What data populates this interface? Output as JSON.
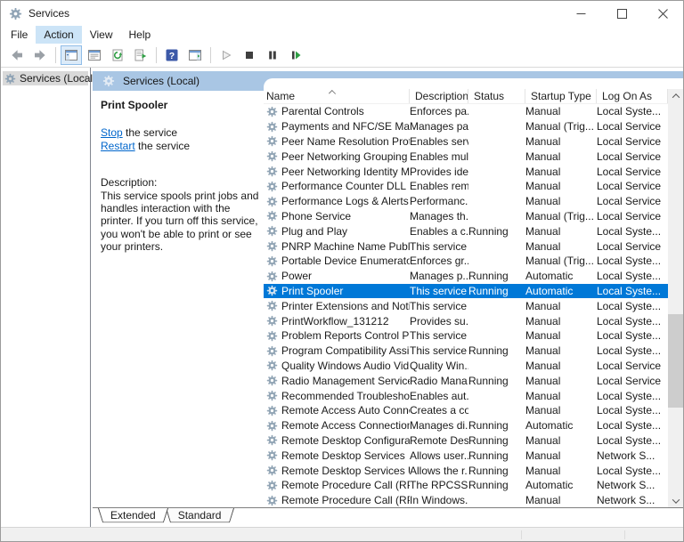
{
  "window": {
    "title": "Services"
  },
  "window_controls": [
    "minimize",
    "maximize",
    "close"
  ],
  "menu": {
    "items": [
      "File",
      "Action",
      "View",
      "Help"
    ],
    "active": "Action"
  },
  "toolbar": {
    "buttons": [
      "back",
      "forward",
      "show-console-tree",
      "properties",
      "refresh",
      "export-list",
      "help",
      "show-action-pane",
      "start-service",
      "stop-service",
      "pause-service",
      "restart-service"
    ],
    "active": "show-console-tree"
  },
  "tree": {
    "root": "Services (Local)"
  },
  "banner": {
    "title": "Services (Local)"
  },
  "task_pane": {
    "service_title": "Print Spooler",
    "stop_link": "Stop",
    "stop_rest": " the service",
    "restart_link": "Restart",
    "restart_rest": " the service",
    "description_label": "Description:",
    "description_text": "This service spools print jobs and handles interaction with the printer. If you turn off this service, you won't be able to print or see your printers."
  },
  "list": {
    "columns": [
      "Name",
      "Description",
      "Status",
      "Startup Type",
      "Log On As"
    ],
    "sorted_column": "Name",
    "sort_direction": "ascending",
    "selected": "Print Spooler",
    "partial_next_row_icon_visible": true,
    "rows": [
      {
        "name": "Parental Controls",
        "description": "Enforces pa...",
        "status": "",
        "startup": "Manual",
        "logon": "Local Syste..."
      },
      {
        "name": "Payments and NFC/SE Man...",
        "description": "Manages pa...",
        "status": "",
        "startup": "Manual (Trig...",
        "logon": "Local Service"
      },
      {
        "name": "Peer Name Resolution Prot...",
        "description": "Enables serv...",
        "status": "",
        "startup": "Manual",
        "logon": "Local Service"
      },
      {
        "name": "Peer Networking Grouping",
        "description": "Enables mul...",
        "status": "",
        "startup": "Manual",
        "logon": "Local Service"
      },
      {
        "name": "Peer Networking Identity M...",
        "description": "Provides ide...",
        "status": "",
        "startup": "Manual",
        "logon": "Local Service"
      },
      {
        "name": "Performance Counter DLL ...",
        "description": "Enables rem...",
        "status": "",
        "startup": "Manual",
        "logon": "Local Service"
      },
      {
        "name": "Performance Logs & Alerts",
        "description": "Performanc...",
        "status": "",
        "startup": "Manual",
        "logon": "Local Service"
      },
      {
        "name": "Phone Service",
        "description": "Manages th...",
        "status": "",
        "startup": "Manual (Trig...",
        "logon": "Local Service"
      },
      {
        "name": "Plug and Play",
        "description": "Enables a c...",
        "status": "Running",
        "startup": "Manual",
        "logon": "Local Syste..."
      },
      {
        "name": "PNRP Machine Name Publi...",
        "description": "This service ...",
        "status": "",
        "startup": "Manual",
        "logon": "Local Service"
      },
      {
        "name": "Portable Device Enumerator...",
        "description": "Enforces gr...",
        "status": "",
        "startup": "Manual (Trig...",
        "logon": "Local Syste..."
      },
      {
        "name": "Power",
        "description": "Manages p...",
        "status": "Running",
        "startup": "Automatic",
        "logon": "Local Syste..."
      },
      {
        "name": "Print Spooler",
        "description": "This service ...",
        "status": "Running",
        "startup": "Automatic",
        "logon": "Local Syste..."
      },
      {
        "name": "Printer Extensions and Notif...",
        "description": "This service ...",
        "status": "",
        "startup": "Manual",
        "logon": "Local Syste..."
      },
      {
        "name": "PrintWorkflow_131212",
        "description": "Provides su...",
        "status": "",
        "startup": "Manual",
        "logon": "Local Syste..."
      },
      {
        "name": "Problem Reports Control Pa...",
        "description": "This service ...",
        "status": "",
        "startup": "Manual",
        "logon": "Local Syste..."
      },
      {
        "name": "Program Compatibility Assi...",
        "description": "This service ...",
        "status": "Running",
        "startup": "Manual",
        "logon": "Local Syste..."
      },
      {
        "name": "Quality Windows Audio Vid...",
        "description": "Quality Win...",
        "status": "",
        "startup": "Manual",
        "logon": "Local Service"
      },
      {
        "name": "Radio Management Service",
        "description": "Radio Mana...",
        "status": "Running",
        "startup": "Manual",
        "logon": "Local Service"
      },
      {
        "name": "Recommended Troublesho...",
        "description": "Enables aut...",
        "status": "",
        "startup": "Manual",
        "logon": "Local Syste..."
      },
      {
        "name": "Remote Access Auto Conne...",
        "description": "Creates a co...",
        "status": "",
        "startup": "Manual",
        "logon": "Local Syste..."
      },
      {
        "name": "Remote Access Connection...",
        "description": "Manages di...",
        "status": "Running",
        "startup": "Automatic",
        "logon": "Local Syste..."
      },
      {
        "name": "Remote Desktop Configurat...",
        "description": "Remote Des...",
        "status": "Running",
        "startup": "Manual",
        "logon": "Local Syste..."
      },
      {
        "name": "Remote Desktop Services",
        "description": "Allows user...",
        "status": "Running",
        "startup": "Manual",
        "logon": "Network S..."
      },
      {
        "name": "Remote Desktop Services U...",
        "description": "Allows the r...",
        "status": "Running",
        "startup": "Manual",
        "logon": "Local Syste..."
      },
      {
        "name": "Remote Procedure Call (RPC)",
        "description": "The RPCSS s...",
        "status": "Running",
        "startup": "Automatic",
        "logon": "Network S..."
      },
      {
        "name": "Remote Procedure Call (RP...",
        "description": "In Windows...",
        "status": "",
        "startup": "Manual",
        "logon": "Network S..."
      }
    ]
  },
  "tabs": {
    "items": [
      "Extended",
      "Standard"
    ],
    "active": "Extended"
  },
  "colors": {
    "selection": "#0078d7",
    "banner": "#a9c6e4",
    "menu_highlight": "#cce4f7",
    "link": "#0066cc",
    "status_bar": "#f0f0f0"
  }
}
